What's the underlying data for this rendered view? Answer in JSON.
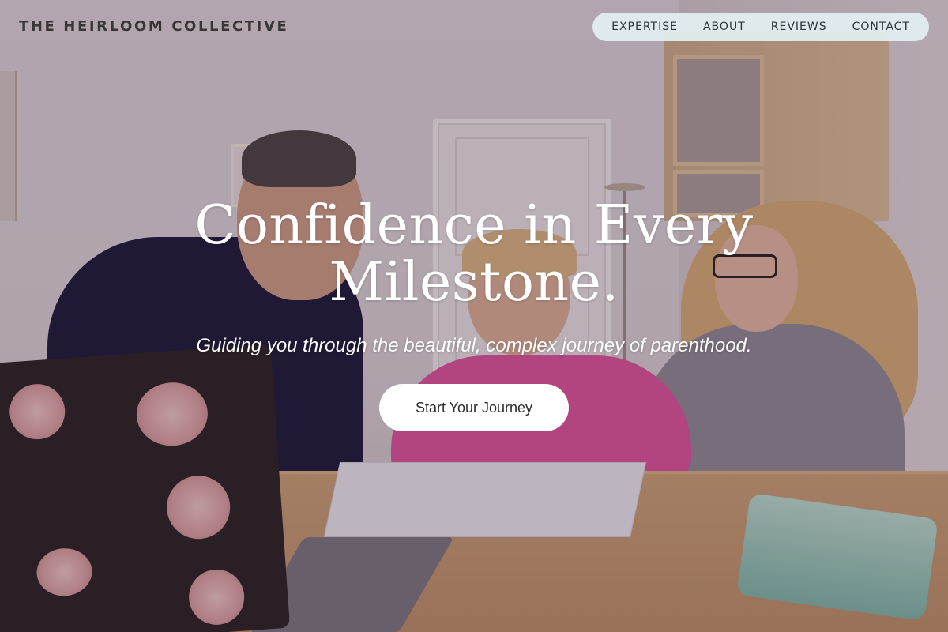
{
  "brand": {
    "name": "THE HEIRLOOM COLLECTIVE"
  },
  "nav": {
    "items": [
      {
        "label": "EXPERTISE"
      },
      {
        "label": "ABOUT"
      },
      {
        "label": "REVIEWS"
      },
      {
        "label": "CONTACT"
      }
    ]
  },
  "hero": {
    "title_line1": "Confidence in Every",
    "title_line2": "Milestone.",
    "subtitle": "Guiding you through the beautiful, complex journey of parenthood.",
    "cta_label": "Start Your Journey"
  },
  "colors": {
    "nav_background": "#e2f0f2",
    "cta_background": "#ffffff",
    "hero_text": "#ffffff",
    "brand_text": "#3a3536"
  }
}
